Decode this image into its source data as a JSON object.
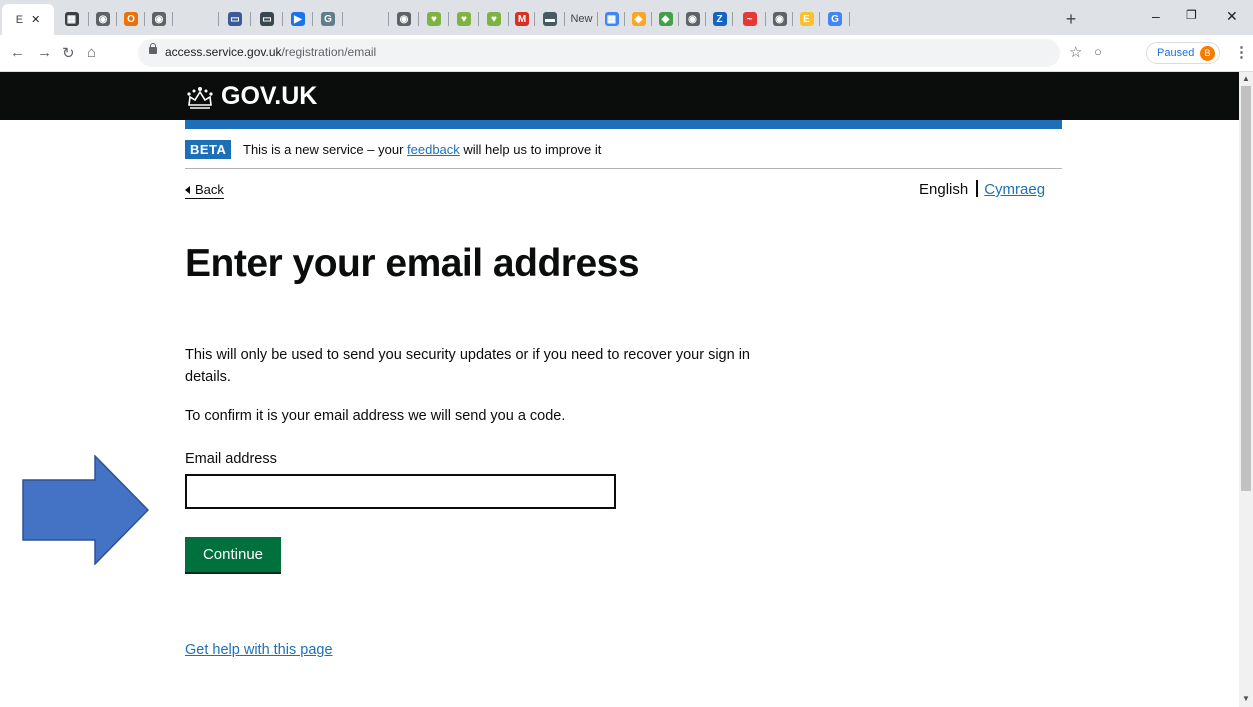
{
  "browser": {
    "tabs": [
      {
        "label": "E",
        "favicon": "",
        "color": "#ffffff",
        "active": true
      },
      {
        "label": "",
        "favicon": "▦",
        "color": "#3c4043"
      },
      {
        "label": "",
        "favicon": "◉",
        "color": "#5f6368"
      },
      {
        "label": "",
        "favicon": "O",
        "color": "#e8710a"
      },
      {
        "label": "",
        "favicon": "◉",
        "color": "#5f6368"
      },
      {
        "label": "",
        "favicon": "",
        "color": "#dee1e6"
      },
      {
        "label": "",
        "favicon": "▭",
        "color": "#3d5a98"
      },
      {
        "label": "",
        "favicon": "▭",
        "color": "#37474f"
      },
      {
        "label": "",
        "favicon": "▶",
        "color": "#1a73e8"
      },
      {
        "label": "",
        "favicon": "G",
        "color": "#607d8b"
      },
      {
        "label": "",
        "favicon": "",
        "color": "#dee1e6"
      },
      {
        "label": "",
        "favicon": "◉",
        "color": "#5f6368"
      },
      {
        "label": "",
        "favicon": "♥",
        "color": "#7cb342"
      },
      {
        "label": "",
        "favicon": "♥",
        "color": "#7cb342"
      },
      {
        "label": "",
        "favicon": "♥",
        "color": "#7cb342"
      },
      {
        "label": "",
        "favicon": "M",
        "color": "#d93025"
      },
      {
        "label": "",
        "favicon": "▬",
        "color": "#455a64"
      },
      {
        "label": "New",
        "favicon": "",
        "color": "#dee1e6"
      },
      {
        "label": "",
        "favicon": "▦",
        "color": "#4285f4"
      },
      {
        "label": "",
        "favicon": "◆",
        "color": "#f9a825"
      },
      {
        "label": "",
        "favicon": "◆",
        "color": "#43a047"
      },
      {
        "label": "",
        "favicon": "◉",
        "color": "#5f6368"
      },
      {
        "label": "",
        "favicon": "Z",
        "color": "#1565c0"
      },
      {
        "label": "",
        "favicon": "~",
        "color": "#e53935"
      },
      {
        "label": "",
        "favicon": "◉",
        "color": "#5f6368"
      },
      {
        "label": "",
        "favicon": "E",
        "color": "#fbc02d"
      },
      {
        "label": "",
        "favicon": "G",
        "color": "#4285f4"
      }
    ],
    "new_tab": "+",
    "url_host": "access.service.gov.uk",
    "url_path": "/registration/email",
    "profile_status": "Paused",
    "profile_initial": "B"
  },
  "header": {
    "logo_text": "GOV.UK"
  },
  "beta_banner": {
    "tag": "BETA",
    "text_before": "This is a new service – your ",
    "link": "feedback",
    "text_after": " will help us to improve it"
  },
  "nav": {
    "back": "Back",
    "lang_current": "English",
    "lang_other": "Cymraeg"
  },
  "main": {
    "title": "Enter your email address",
    "para1": "This will only be used to send you security updates or if you need to recover your sign in details.",
    "para2": "To confirm it is your email address we will send you a code.",
    "email_label": "Email address",
    "email_value": "",
    "continue": "Continue",
    "help_link": "Get help with this page"
  },
  "colors": {
    "gov_black": "#0b0c0c",
    "gov_blue": "#1d70b8",
    "gov_green": "#00703c",
    "annotation_arrow": "#4472c4"
  }
}
